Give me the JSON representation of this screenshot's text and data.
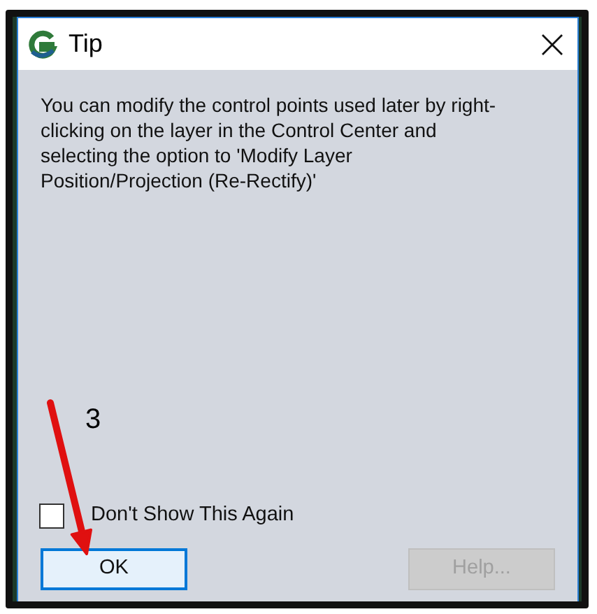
{
  "window": {
    "title": "Tip"
  },
  "message": "You can modify the control points used later by right-clicking on the layer in the Control Center and selecting the option to 'Modify Layer Position/Projection (Re-Rectify)'",
  "checkbox": {
    "label": "Don't Show This Again",
    "checked": false
  },
  "buttons": [
    {
      "label": "OK",
      "disabled": false,
      "focused": true
    },
    {
      "label": "Help...",
      "disabled": true,
      "focused": false
    }
  ],
  "annotation": {
    "label": "3"
  }
}
